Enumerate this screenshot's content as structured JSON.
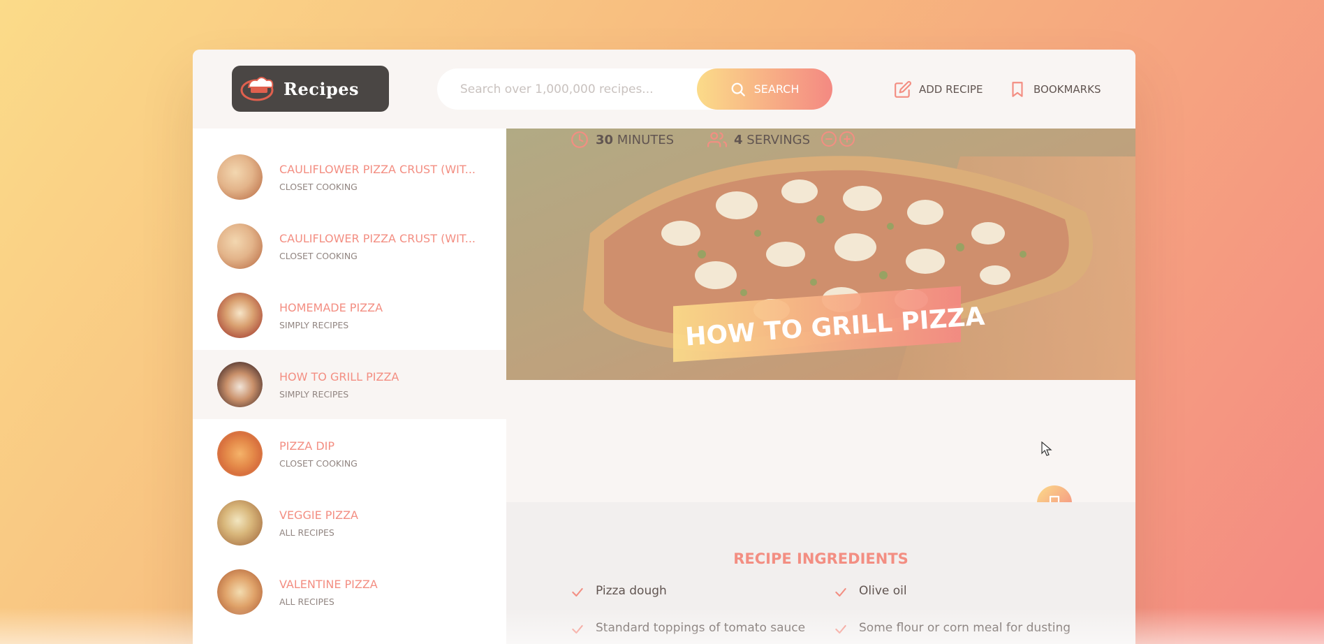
{
  "header": {
    "logo_text": "Recipes",
    "search_placeholder": "Search over 1,000,000 recipes...",
    "search_button": "SEARCH",
    "add_recipe": "ADD RECIPE",
    "bookmarks": "BOOKMARKS"
  },
  "results": [
    {
      "title": "CAULIFLOWER PIZZA CRUST (WIT...",
      "publisher": "CLOSET COOKING",
      "active": false
    },
    {
      "title": "CAULIFLOWER PIZZA CRUST (WIT...",
      "publisher": "CLOSET COOKING",
      "active": false
    },
    {
      "title": "HOMEMADE PIZZA",
      "publisher": "SIMPLY RECIPES",
      "active": false
    },
    {
      "title": "HOW TO GRILL PIZZA",
      "publisher": "SIMPLY RECIPES",
      "active": true
    },
    {
      "title": "PIZZA DIP",
      "publisher": "CLOSET COOKING",
      "active": false
    },
    {
      "title": "VEGGIE PIZZA",
      "publisher": "ALL RECIPES",
      "active": false
    },
    {
      "title": "VALENTINE PIZZA",
      "publisher": "ALL RECIPES",
      "active": false
    }
  ],
  "recipe": {
    "title": "HOW TO GRILL PIZZA",
    "minutes_value": "30",
    "minutes_label": "MINUTES",
    "servings_value": "4",
    "servings_label": "SERVINGS"
  },
  "ingredients": {
    "heading": "RECIPE INGREDIENTS",
    "items": [
      "Pizza dough",
      "Olive oil",
      "Standard toppings of tomato sauce",
      "Some flour or corn meal for dusting"
    ]
  },
  "colors": {
    "accent": "#f38e82",
    "gradient_start": "#fbdb89",
    "gradient_end": "#f48982",
    "text": "#615551"
  }
}
